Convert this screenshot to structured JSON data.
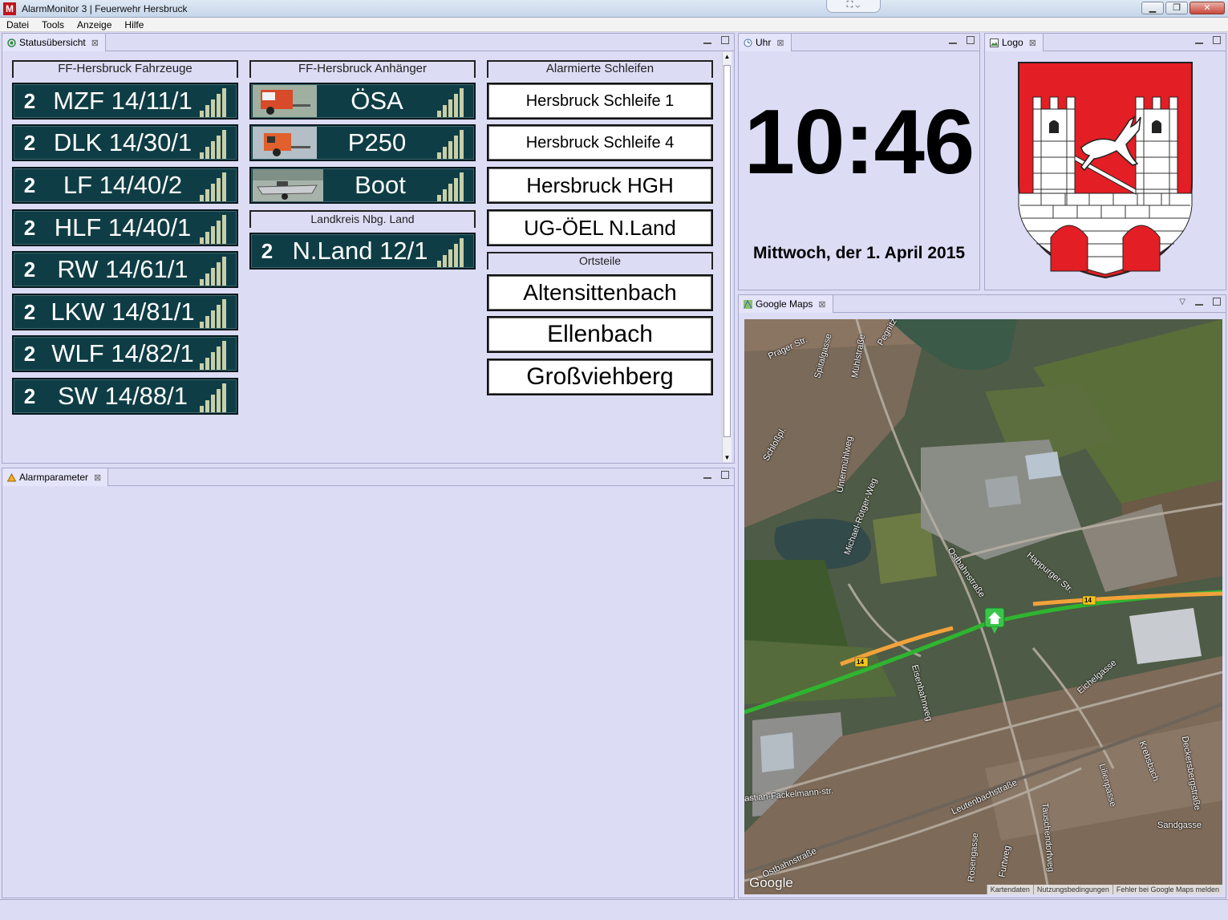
{
  "window": {
    "title": "AlarmMonitor 3 | Feuerwehr Hersbruck",
    "app_icon_letter": "M"
  },
  "menu": [
    "Datei",
    "Tools",
    "Anzeige",
    "Hilfe"
  ],
  "status_panel": {
    "tab_label": "Statusübersicht",
    "sections": {
      "fahrzeuge": "FF-Hersbruck Fahrzeuge",
      "anhaenger": "FF-Hersbruck Anhänger",
      "landkreis": "Landkreis Nbg. Land",
      "schleifen": "Alarmierte Schleifen",
      "ortsteile": "Ortsteile"
    },
    "vehicles": [
      {
        "status": "2",
        "name": "MZF 14/11/1"
      },
      {
        "status": "2",
        "name": "DLK 14/30/1"
      },
      {
        "status": "2",
        "name": "LF 14/40/2"
      },
      {
        "status": "2",
        "name": "HLF 14/40/1"
      },
      {
        "status": "2",
        "name": "RW 14/61/1"
      },
      {
        "status": "2",
        "name": "LKW 14/81/1"
      },
      {
        "status": "2",
        "name": "WLF 14/82/1"
      },
      {
        "status": "2",
        "name": "SW 14/88/1"
      }
    ],
    "trailers": [
      {
        "name": "ÖSA"
      },
      {
        "name": "P250"
      },
      {
        "name": "Boot"
      }
    ],
    "landkreis_vehicle": {
      "status": "2",
      "name": "N.Land 12/1"
    },
    "loops": [
      "Hersbruck Schleife 1",
      "Hersbruck Schleife 4",
      "Hersbruck HGH",
      "UG-ÖEL N.Land"
    ],
    "districts": [
      "Altensittenbach",
      "Ellenbach",
      "Großviehberg"
    ]
  },
  "alarm_panel": {
    "tab_label": "Alarmparameter"
  },
  "clock_panel": {
    "tab_label": "Uhr",
    "time": "10:46",
    "date": "Mittwoch, der 1. April 2015"
  },
  "logo_panel": {
    "tab_label": "Logo"
  },
  "map_panel": {
    "tab_label": "Google Maps",
    "google_logo": "Google",
    "footer": [
      "Kartendaten",
      "Nutzungsbedingungen",
      "Fehler bei Google Maps melden"
    ],
    "road_number": "14",
    "street_labels": [
      "Prager Str.",
      "Spitalgasse",
      "Mühlstraße",
      "Pegnitz",
      "Schloßpl.",
      "Untermühlweg",
      "Michael-Rötger-Weg",
      "Ostbahnstraße",
      "Happurger Str.",
      "Eisenbahnweg",
      "Eichelgasse",
      "Krebsbach",
      "Deckersbergstraße",
      "Sandgasse",
      "Lilienpasse",
      "Leutenbachstraße",
      "Tauschendorfweg",
      "Rosengasse",
      "Furtweg",
      "astian-Fackelmann-str.",
      "Ostbahnstraße"
    ]
  },
  "colors": {
    "background": "#dcdcf5",
    "vehicle_fill": "#0f3d45",
    "signal_bars": "#c8cfa8",
    "crest_red": "#e31e24",
    "traffic_green": "#2fb52f",
    "traffic_orange": "#f2a23a"
  }
}
